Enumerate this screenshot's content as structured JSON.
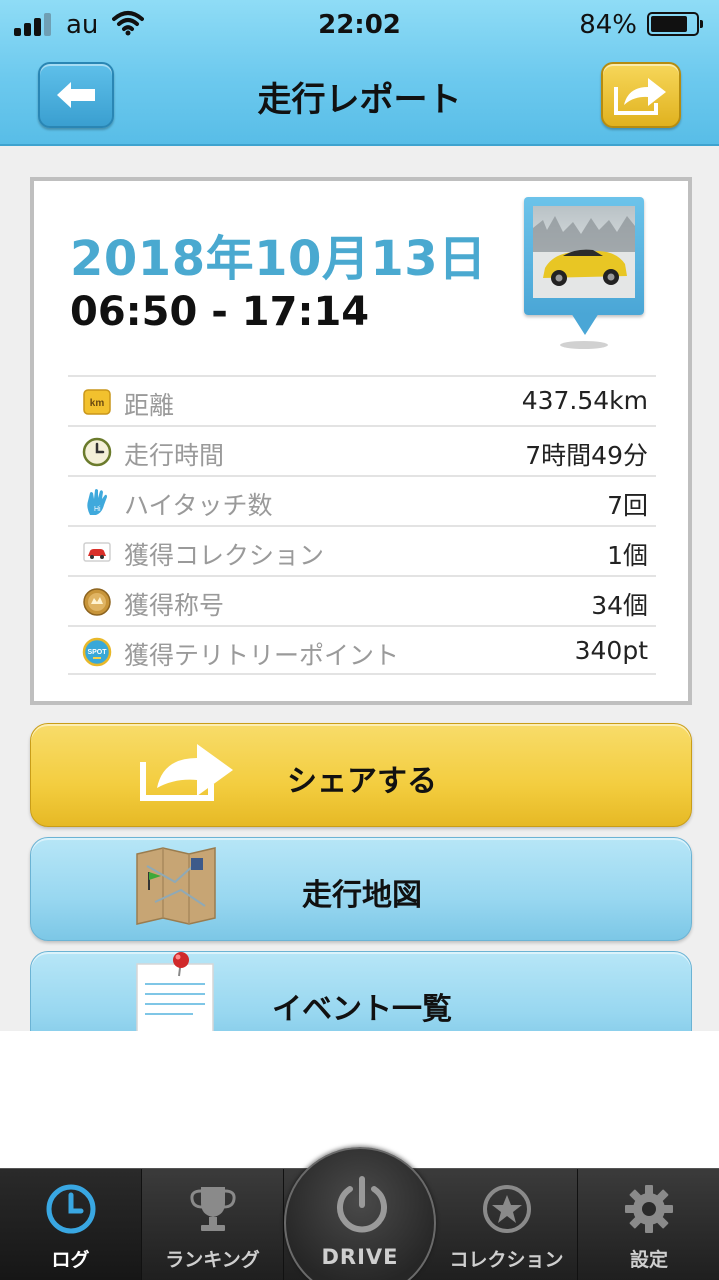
{
  "status_bar": {
    "carrier": "au",
    "time": "22:02",
    "battery_percent_label": "84%",
    "battery_level": 0.84,
    "signal_bars_active": 3,
    "signal_bars_total": 4
  },
  "header": {
    "title": "走行レポート",
    "back_icon": "arrow-left-icon",
    "share_icon": "share-arrow-icon"
  },
  "report": {
    "date": "2018年10月13日",
    "time_range": "06:50 - 17:14",
    "photo_icon": "car-photo-pin-icon",
    "stats": [
      {
        "icon": "km-icon",
        "label": "距離",
        "value": "437.54km"
      },
      {
        "icon": "clock-icon",
        "label": "走行時間",
        "value": "7時間49分"
      },
      {
        "icon": "high-five-icon",
        "label": "ハイタッチ数",
        "value": "7回"
      },
      {
        "icon": "car-card-icon",
        "label": "獲得コレクション",
        "value": "1個"
      },
      {
        "icon": "medal-icon",
        "label": "獲得称号",
        "value": "34個"
      },
      {
        "icon": "spot-icon",
        "label": "獲得テリトリーポイント",
        "value": "340pt"
      }
    ]
  },
  "actions": {
    "share": {
      "label": "シェアする",
      "icon": "share-arrow-icon"
    },
    "map": {
      "label": "走行地図",
      "icon": "map-icon"
    },
    "events": {
      "label": "イベント一覧",
      "icon": "memo-pin-icon"
    }
  },
  "tabbar": {
    "tabs": [
      {
        "label": "ログ",
        "icon": "clock-icon",
        "active": true
      },
      {
        "label": "ランキング",
        "icon": "trophy-icon",
        "active": false
      },
      {
        "label": "DRIVE",
        "icon": "power-icon",
        "active": false
      },
      {
        "label": "コレクション",
        "icon": "star-icon",
        "active": false
      },
      {
        "label": "設定",
        "icon": "gear-icon",
        "active": false
      }
    ]
  },
  "colors": {
    "header_blue": "#6cc9ee",
    "date_blue": "#4aa9d0",
    "share_yellow": "#f3cd3f",
    "map_blue": "#98d7f0",
    "tabbar_dark": "#2b2b2b"
  }
}
